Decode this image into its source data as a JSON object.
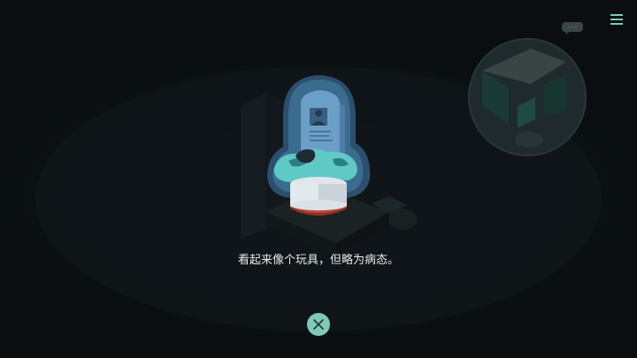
{
  "popup": {
    "caption": "看起来像个玩具，但略为病态。"
  },
  "icons": {
    "menu": "hamburger-menu-icon",
    "close": "close-icon",
    "bubble": "speech-bubble-icon",
    "item": "tombstone-toy-icon"
  },
  "colors": {
    "background": "#0a0e11",
    "accent": "#7fc9b9",
    "glow": "#3a6c8e",
    "tombstone": "#6b9fc8",
    "base_red": "#c04a3a",
    "text": "#e8ecee"
  }
}
